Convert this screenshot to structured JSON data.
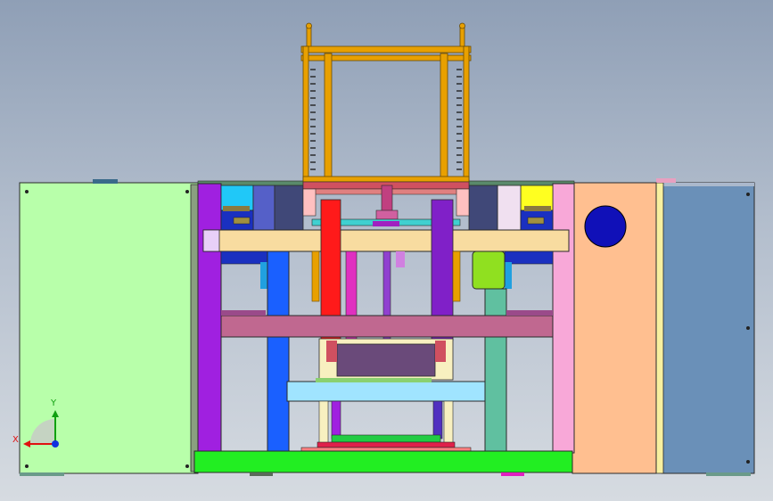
{
  "viewport": {
    "background": "gradient",
    "triad": {
      "x_label": "X",
      "y_label": "Y",
      "x_color": "#e01010",
      "y_color": "#10a010",
      "z_color": "#1030e0"
    }
  },
  "colors": {
    "left_cabinet": "#b8ffaa",
    "right_cabinet": "#6a90b8",
    "side_panel_orange": "#ffbf90",
    "purple_column": "#a020e0",
    "pink_column": "#f8a8d8",
    "base": "#22ee22",
    "top_frame": "#e8a000",
    "beam_tan": "#f8dca0",
    "beam_mauve": "#c06890",
    "light_blue_plate": "#a0e4ff",
    "red_rod": "#ff1a1a",
    "blue_column": "#1a60ff",
    "teal_column": "#60c0a0",
    "yellow_block": "#ffff20",
    "cyan_block": "#20c8f8",
    "navy_motor": "#1010b8",
    "lime_cylinder": "#90e020"
  }
}
